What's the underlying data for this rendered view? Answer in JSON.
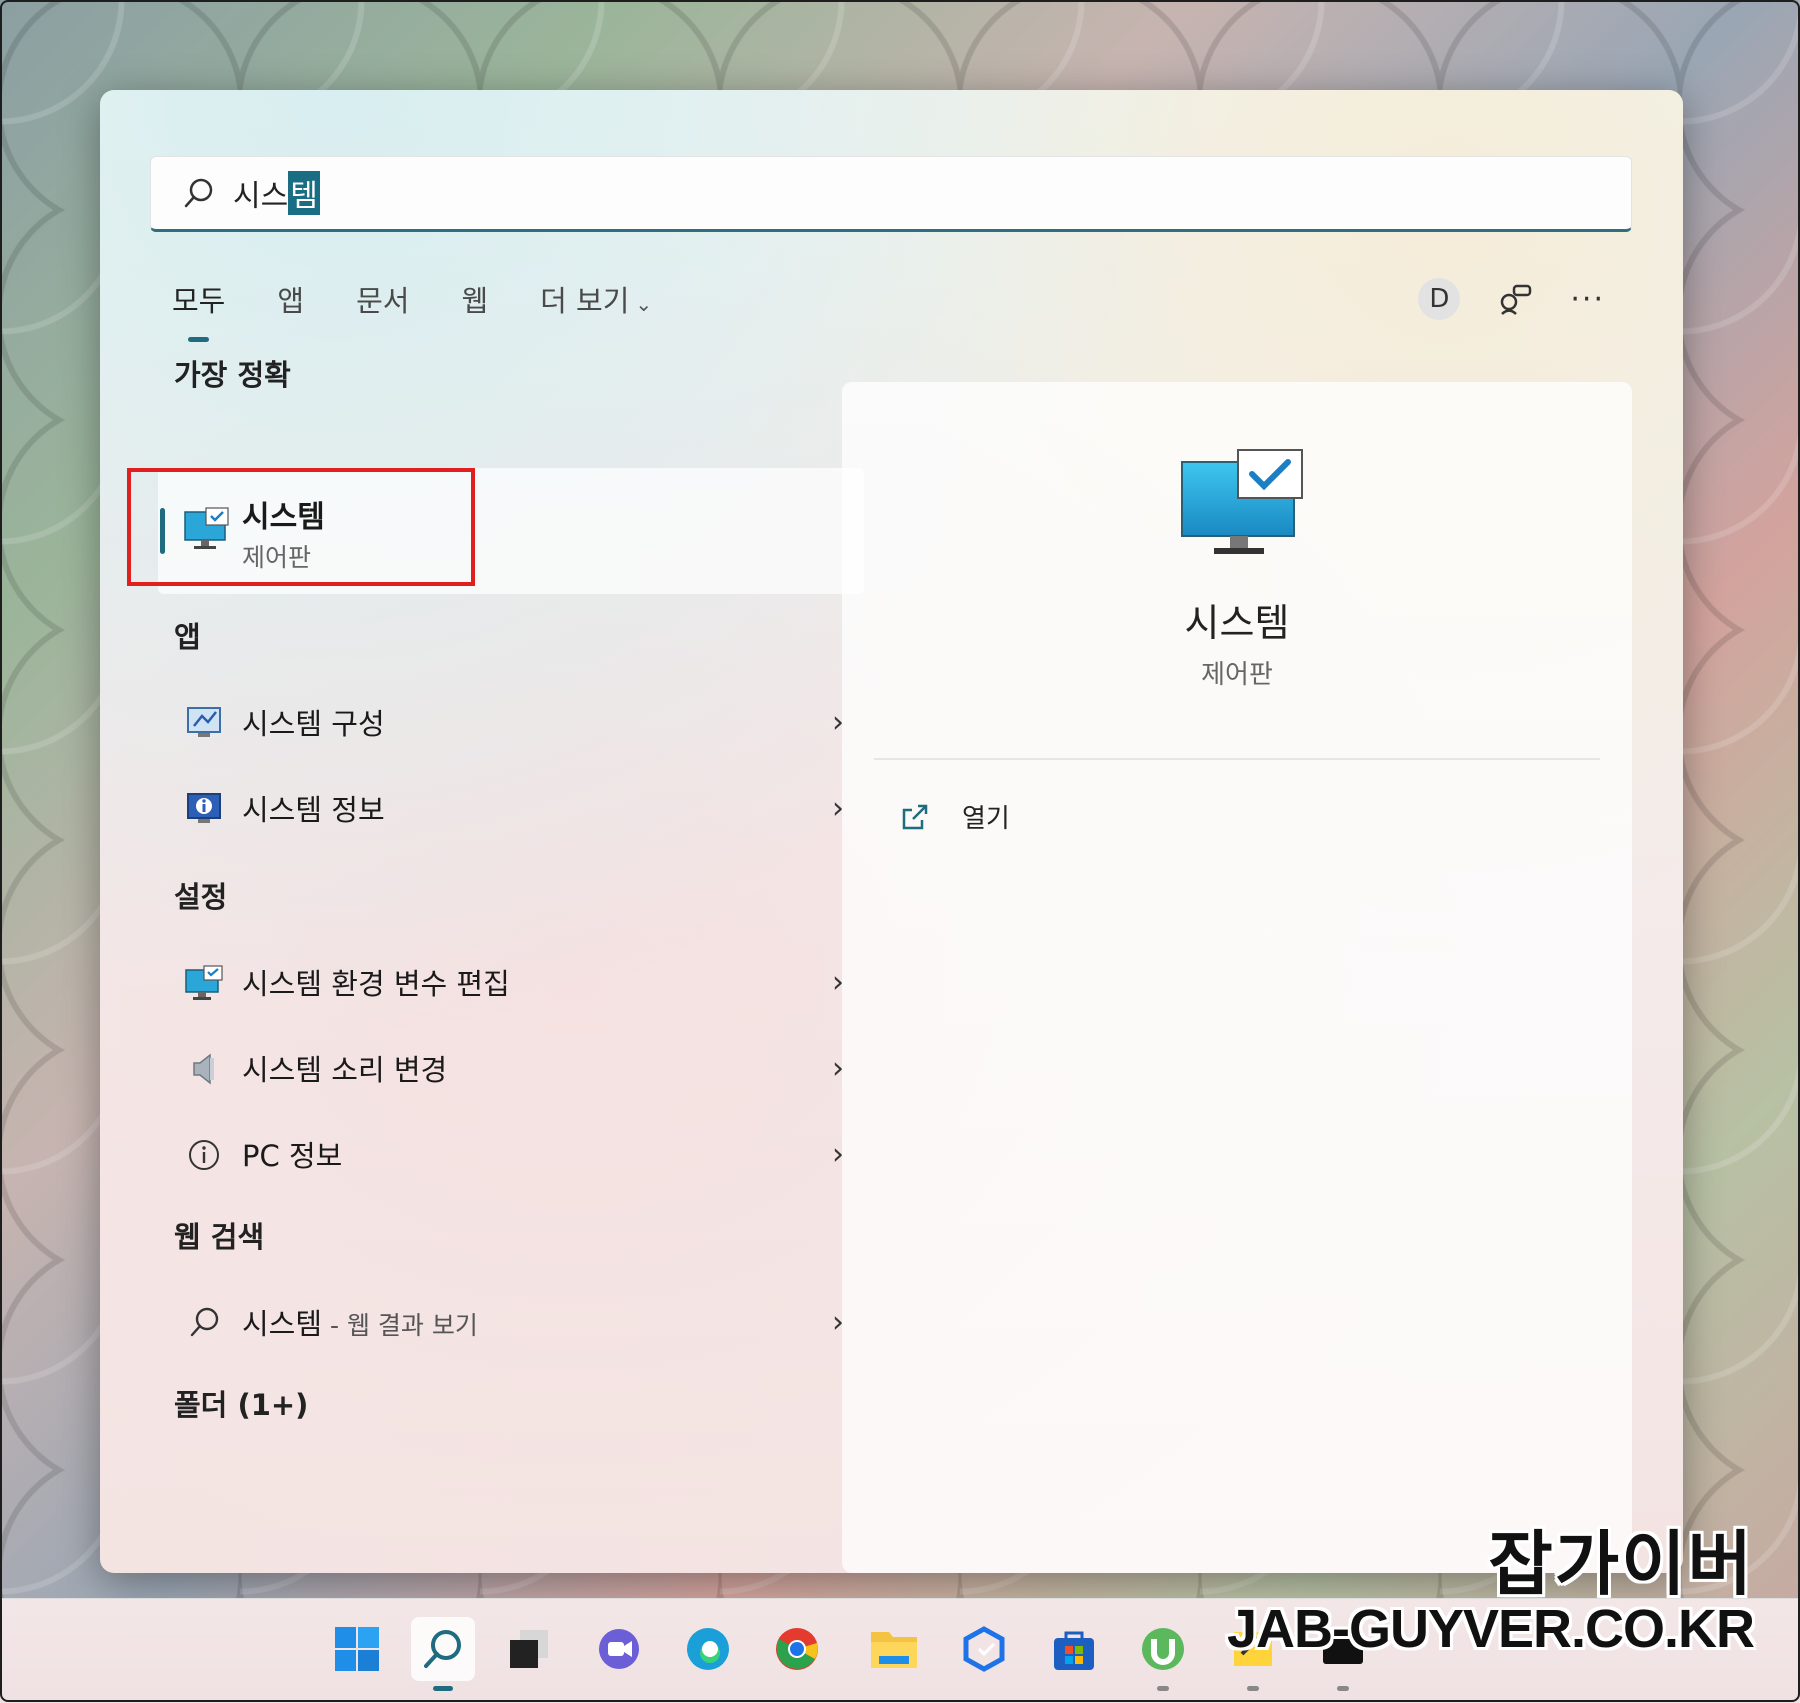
{
  "search": {
    "query_prefix": "시스",
    "query_selected": "템"
  },
  "tabs": [
    {
      "label": "모두"
    },
    {
      "label": "앱"
    },
    {
      "label": "문서"
    },
    {
      "label": "웹"
    },
    {
      "label": "더 보기"
    }
  ],
  "header": {
    "avatar_letter": "D",
    "more_label": "···"
  },
  "sections": {
    "best_match": "가장 정확",
    "apps": "앱",
    "settings": "설정",
    "web_search": "웹 검색",
    "folders": "폴더 (1+)"
  },
  "best_match": {
    "title": "시스템",
    "subtitle": "제어판"
  },
  "apps": [
    {
      "label": "시스템 구성",
      "icon": "system-config-icon"
    },
    {
      "label": "시스템 정보",
      "icon": "system-info-icon"
    }
  ],
  "settings": [
    {
      "label": "시스템 환경 변수 편집",
      "icon": "monitor-icon"
    },
    {
      "label": "시스템 소리 변경",
      "icon": "speaker-icon"
    },
    {
      "label": "PC 정보",
      "icon": "info-icon"
    }
  ],
  "web_result": {
    "label": "시스템",
    "suffix": " - 웹 결과 보기"
  },
  "preview": {
    "title": "시스템",
    "subtitle": "제어판",
    "open_label": "열기"
  },
  "taskbar": [
    "start-icon",
    "search-icon",
    "task-view-icon",
    "chat-icon",
    "edge-icon",
    "chrome-icon",
    "file-explorer-icon",
    "app-icon",
    "store-icon",
    "utorrent-icon",
    "sticky-icon",
    "terminal-icon"
  ],
  "watermark": {
    "line1": "잡가이버",
    "line2": "JAB-GUYVER.CO.KR"
  },
  "colors": {
    "accent": "#1f6b80",
    "highlight": "#e0201f"
  }
}
